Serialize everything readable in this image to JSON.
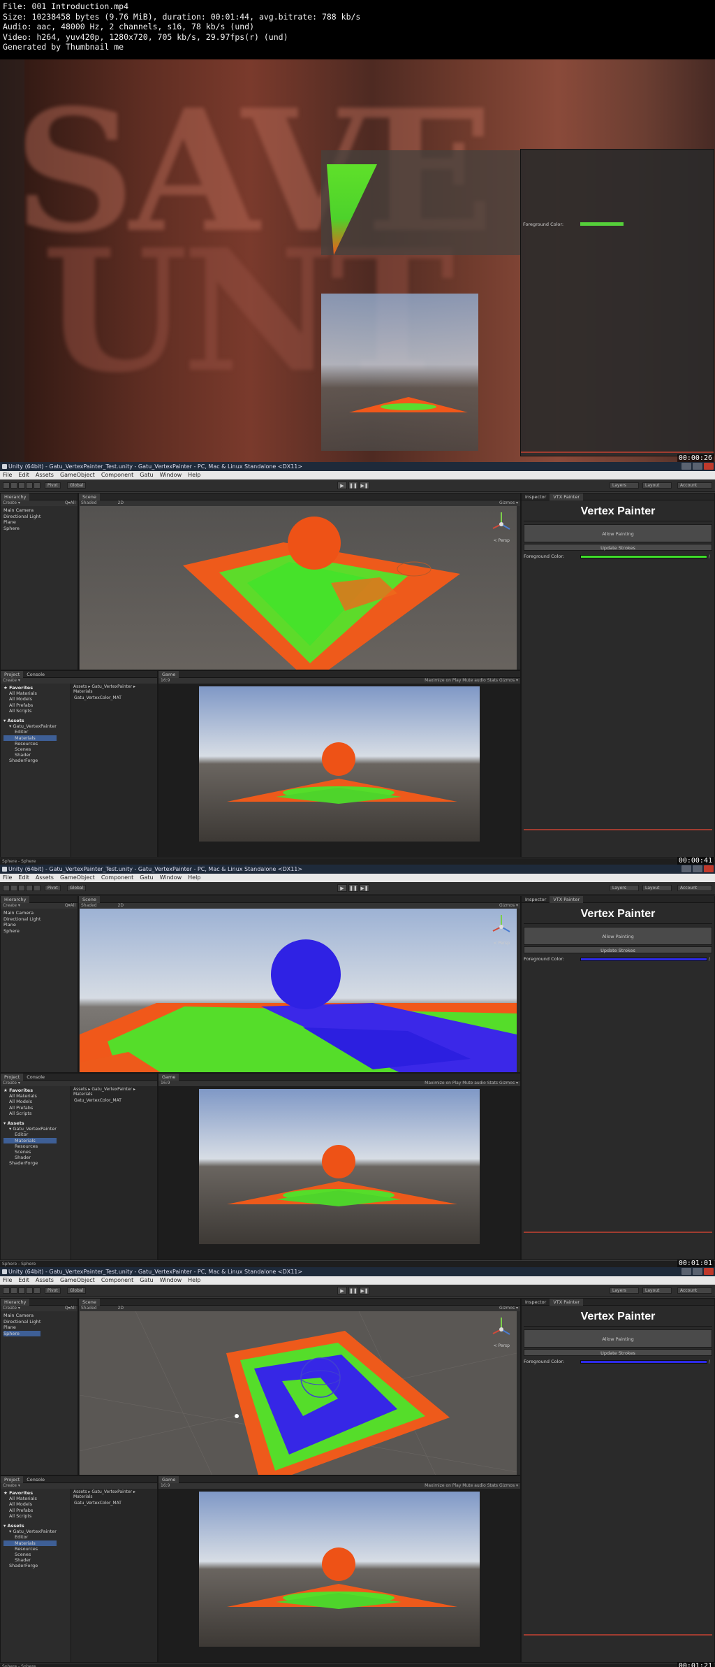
{
  "header": {
    "lines": [
      "File: 001 Introduction.mp4",
      "Size: 10238458 bytes (9.76 MiB), duration: 00:01:44, avg.bitrate: 788 kb/s",
      "Audio: aac, 48000 Hz, 2 channels, s16, 78 kb/s (und)",
      "Video: h264, yuv420p, 1280x720, 705 kb/s, 29.97fps(r) (und)",
      "Generated by Thumbnail me"
    ]
  },
  "frames": [
    {
      "timestamp": "00:00:26",
      "intro_letters": [
        "SAVE",
        "UNT"
      ],
      "inspector": {
        "fg_label": "Foreground Color:",
        "fg_color": "#55d03a"
      },
      "game_bar": {
        "right": "Maximize on Play   Mute audio   Stats   Gizmos"
      },
      "status": "Sphere - Sphere"
    },
    {
      "timestamp": "00:00:41",
      "brush": "green",
      "fg_color": "#3fe02a"
    },
    {
      "timestamp": "00:01:01",
      "brush": "blue",
      "fg_color": "#2d2ae6"
    },
    {
      "timestamp": "00:01:21",
      "brush": "blue",
      "fg_color": "#2d2ae6"
    }
  ],
  "unity": {
    "title": "Unity (64bit) - Gatu_VertexPainter_Test.unity - Gatu_VertexPainter - PC, Mac & Linux Standalone <DX11>",
    "menu": [
      "File",
      "Edit",
      "Assets",
      "GameObject",
      "Component",
      "Gatu",
      "Window",
      "Help"
    ],
    "toolbar": {
      "pivot": "Pivot",
      "global": "Global",
      "layers": "Layers",
      "layout": "Layout",
      "account": "Account"
    },
    "hierarchy": {
      "tab": "Hierarchy",
      "create": "Create ▾",
      "search": "Q▾All",
      "items": [
        "Main Camera",
        "Directional Light",
        "Plane",
        "Sphere"
      ]
    },
    "scene": {
      "tab": "Scene",
      "shaded": "Shaded",
      "twod": "2D",
      "gizmos": "Gizmos ▾",
      "persp": "< Persp"
    },
    "project": {
      "tabs": [
        "Project",
        "Console"
      ],
      "create": "Create ▾",
      "tree": [
        {
          "label": "★ Favorites",
          "lvl": 0,
          "hdr": true
        },
        {
          "label": "All Materials",
          "lvl": 1
        },
        {
          "label": "All Models",
          "lvl": 1
        },
        {
          "label": "All Prefabs",
          "lvl": 1
        },
        {
          "label": "All Scripts",
          "lvl": 1
        },
        {
          "label": "",
          "lvl": 0
        },
        {
          "label": "▾ Assets",
          "lvl": 0,
          "hdr": true
        },
        {
          "label": "▾ Gatu_VertexPainter",
          "lvl": 1
        },
        {
          "label": "Editor",
          "lvl": 2
        },
        {
          "label": "Materials",
          "lvl": 2,
          "sel": true
        },
        {
          "label": "Resources",
          "lvl": 2
        },
        {
          "label": "Scenes",
          "lvl": 2
        },
        {
          "label": "Shader",
          "lvl": 2
        },
        {
          "label": "ShaderForge",
          "lvl": 1
        }
      ],
      "crumb": "Assets ▸ Gatu_VertexPainter ▸ Materials",
      "asset": "Gatu_VertexColor_MAT"
    },
    "game": {
      "tab": "Game",
      "aspect": "16:9",
      "bar_right": "Maximize on Play   Mute audio   Stats   Gizmos ▾"
    },
    "inspector": {
      "tabs": [
        "Inspector",
        "VTX Painter"
      ],
      "title": "Vertex Painter",
      "allow_btn": "Allow Painting",
      "update_btn": "Update Strokes",
      "fg_label": "Foreground Color:"
    },
    "status": "Sphere - Sphere"
  }
}
